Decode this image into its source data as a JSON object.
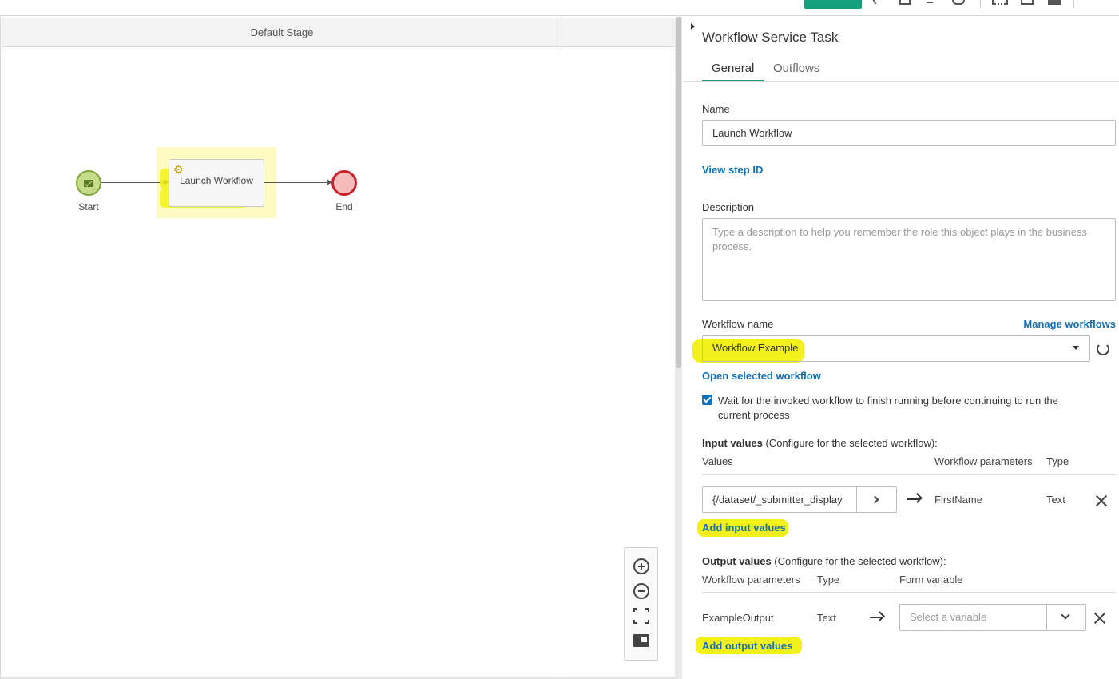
{
  "canvas": {
    "stage_title": "Default Stage",
    "nodes": {
      "start_label": "Start",
      "task_label": "Launch Workflow",
      "end_label": "End"
    }
  },
  "panel": {
    "title": "Workflow Service Task",
    "tabs": [
      "General",
      "Outflows"
    ],
    "active_tab": "General",
    "name_label": "Name",
    "name_value": "Launch Workflow",
    "view_step_id": "View step ID",
    "description_label": "Description",
    "description_placeholder": "Type a description to help you remember the role this object plays in the business process.",
    "workflow_name_label": "Workflow name",
    "manage_workflows": "Manage workflows",
    "workflow_selected": "Workflow Example",
    "open_selected_workflow": "Open selected workflow",
    "wait_checkbox": {
      "checked": true,
      "line1": "Wait for the invoked workflow to finish running before continuing to run the",
      "line2": "current process"
    },
    "input_values": {
      "heading_bold": "Input values",
      "heading_rest": " (Configure for the selected workflow):",
      "columns": [
        "Values",
        "Workflow parameters",
        "Type"
      ],
      "rows": [
        {
          "value": "{/dataset/_submitter_display",
          "parameter": "FirstName",
          "type": "Text"
        }
      ],
      "add_label": "Add input values"
    },
    "output_values": {
      "heading_bold": "Output values",
      "heading_rest": " (Configure for the selected workflow):",
      "columns": [
        "Workflow parameters",
        "Type",
        "Form variable"
      ],
      "rows": [
        {
          "parameter": "ExampleOutput",
          "type": "Text",
          "variable_placeholder": "Select a variable"
        }
      ],
      "add_label": "Add output values"
    }
  },
  "colors": {
    "accent": "#159f7a",
    "link": "#1170b8",
    "highlight": "#f3f11a",
    "start_fill": "#c6dc8a",
    "end_stroke": "#c8232c"
  }
}
